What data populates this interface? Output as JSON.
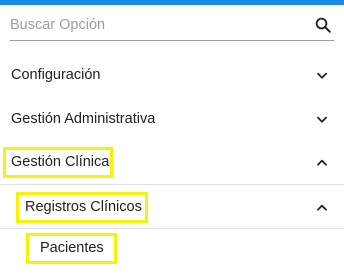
{
  "search": {
    "placeholder": "Buscar Opción",
    "icon": "search-icon"
  },
  "menu": {
    "items": [
      {
        "label": "Configuración",
        "state": "collapsed",
        "icon": "chevron-down-icon"
      },
      {
        "label": "Gestión Administrativa",
        "state": "collapsed",
        "icon": "chevron-down-icon"
      },
      {
        "label": "Gestión Clínica",
        "state": "expanded",
        "highlighted": true,
        "icon": "chevron-up-icon",
        "children": [
          {
            "label": "Registros Clínicos",
            "state": "expanded",
            "highlighted": true,
            "icon": "chevron-up-icon",
            "children": [
              {
                "label": "Pacientes",
                "highlighted": true
              }
            ]
          }
        ]
      }
    ]
  },
  "colors": {
    "accent_bar": "#1e88e5",
    "highlight": "#f5f20b",
    "text": "#212121",
    "placeholder": "#9e9e9e",
    "divider": "#e0e0e0"
  }
}
